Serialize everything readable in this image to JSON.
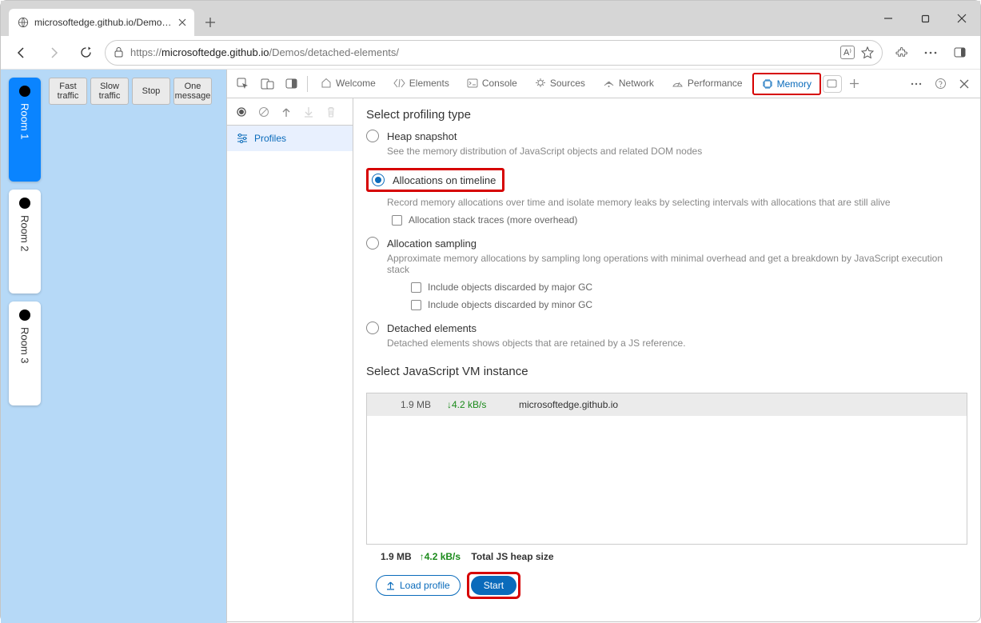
{
  "tab": {
    "label": "microsoftedge.github.io/Demos/c"
  },
  "url": {
    "host": "microsoftedge.github.io",
    "path": "/Demos/detached-elements/",
    "prefix": "https://"
  },
  "rooms": [
    {
      "label": "Room 1",
      "selected": true
    },
    {
      "label": "Room 2",
      "selected": false
    },
    {
      "label": "Room 3",
      "selected": false
    }
  ],
  "traffic_buttons": [
    "Fast\ntraffic",
    "Slow\ntraffic",
    "Stop",
    "One\nmessage"
  ],
  "devtools_tabs": [
    "Welcome",
    "Elements",
    "Console",
    "Sources",
    "Network",
    "Performance",
    "Memory"
  ],
  "profiles_label": "Profiles",
  "panel": {
    "title1": "Select profiling type",
    "opts": [
      {
        "label": "Heap snapshot",
        "desc": "See the memory distribution of JavaScript objects and related DOM nodes"
      },
      {
        "label": "Allocations on timeline",
        "desc": "Record memory allocations over time and isolate memory leaks by selecting intervals with allocations that are still alive",
        "sub": [
          "Allocation stack traces (more overhead)"
        ]
      },
      {
        "label": "Allocation sampling",
        "desc": "Approximate memory allocations by sampling long operations with minimal overhead and get a breakdown by JavaScript execution stack",
        "sub": [
          "Include objects discarded by major GC",
          "Include objects discarded by minor GC"
        ]
      },
      {
        "label": "Detached elements",
        "desc": "Detached elements shows objects that are retained by a JS reference."
      }
    ],
    "title2": "Select JavaScript VM instance",
    "vm": {
      "mem": "1.9 MB",
      "rate": "↓4.2 kB/s",
      "origin": "microsoftedge.github.io"
    },
    "footer": {
      "mem": "1.9 MB",
      "rate": "↑4.2 kB/s",
      "label": "Total JS heap size"
    },
    "load_btn": "Load profile",
    "start_btn": "Start"
  }
}
